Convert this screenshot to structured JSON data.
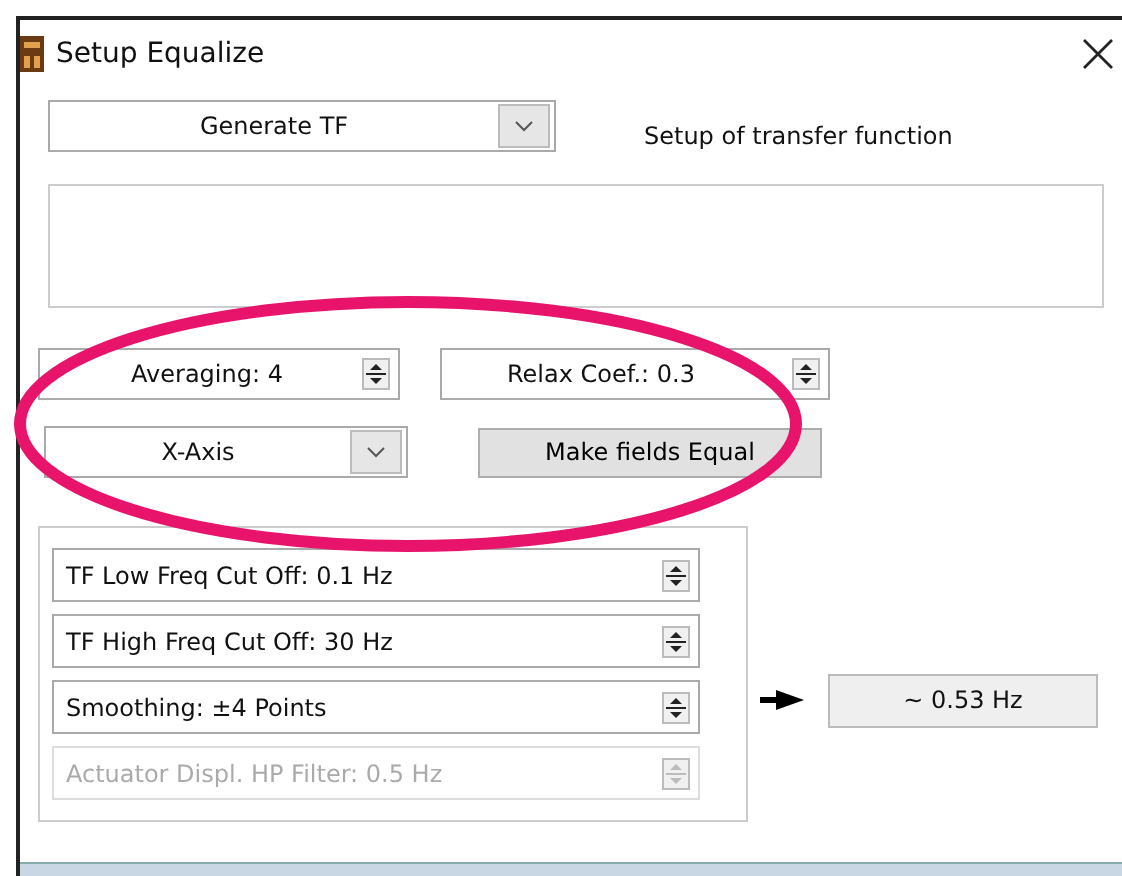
{
  "window": {
    "title": "Setup Equalize"
  },
  "mode_select": {
    "value": "Generate TF"
  },
  "description": "Setup of transfer function",
  "spinners": [
    {
      "value": "Averaging: 4",
      "disabled": false
    },
    {
      "value": "Relax Coef.: 0.3",
      "disabled": false
    }
  ],
  "axis_select": {
    "value": "X-Axis"
  },
  "equal_button": "Make fields Equal",
  "filters": [
    {
      "value": "TF Low Freq Cut Off: 0.1 Hz",
      "disabled": false
    },
    {
      "value": "TF High Freq Cut Off: 30 Hz",
      "disabled": false
    },
    {
      "value": "Smoothing: ±4 Points",
      "disabled": false
    },
    {
      "value": "Actuator Displ. HP Filter: 0.5 Hz",
      "disabled": true
    }
  ],
  "smoothing_readout": "~ 0.53 Hz"
}
